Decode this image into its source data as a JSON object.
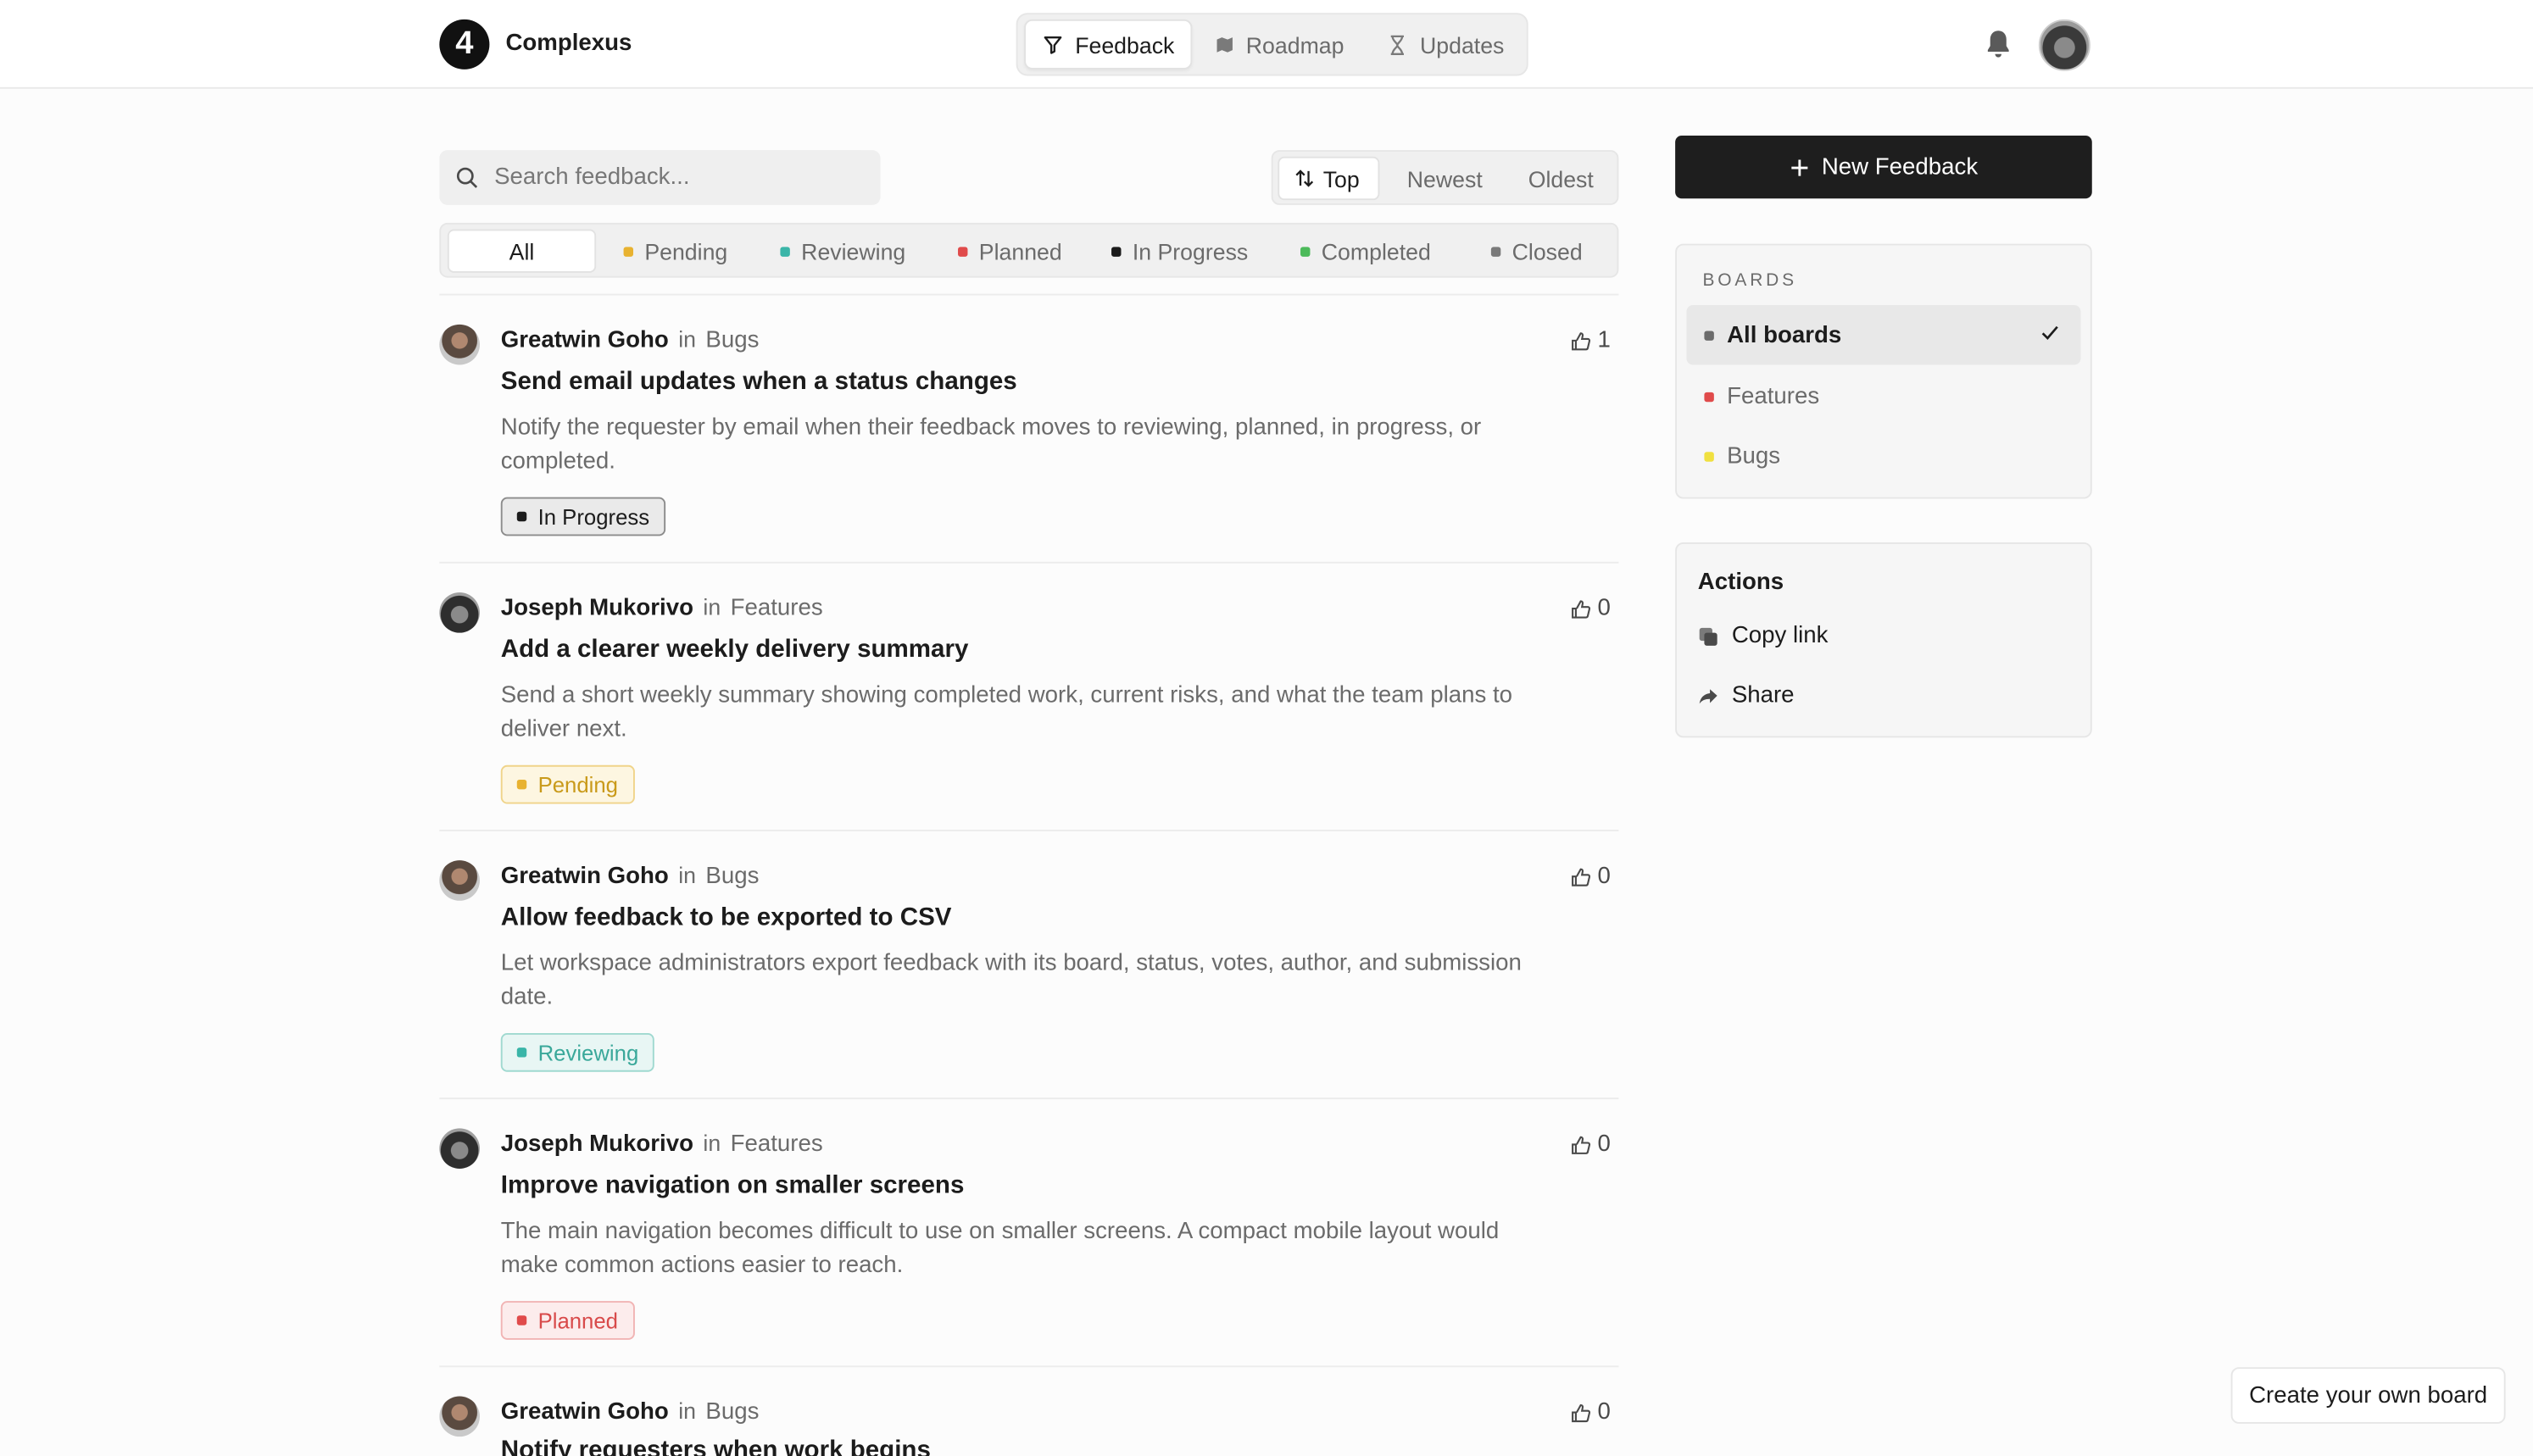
{
  "header": {
    "brand": "Complexus",
    "logo_text": "4",
    "tabs": [
      {
        "label": "Feedback",
        "icon": "filter-funnel-icon",
        "active": true
      },
      {
        "label": "Roadmap",
        "icon": "map-icon",
        "active": false
      },
      {
        "label": "Updates",
        "icon": "hourglass-icon",
        "active": false
      }
    ]
  },
  "search": {
    "placeholder": "Search feedback..."
  },
  "sort": {
    "options": [
      "Top",
      "Newest",
      "Oldest"
    ],
    "selected": "Top"
  },
  "filters": {
    "options": [
      {
        "label": "All",
        "color": null
      },
      {
        "label": "Pending",
        "color": "#e8b230"
      },
      {
        "label": "Reviewing",
        "color": "#3ab5a8"
      },
      {
        "label": "Planned",
        "color": "#e04b4b"
      },
      {
        "label": "In Progress",
        "color": "#1c1c1c"
      },
      {
        "label": "Completed",
        "color": "#4cba5a"
      },
      {
        "label": "Closed",
        "color": "#7a7a7a"
      }
    ],
    "selected": "All"
  },
  "posts": [
    {
      "author": "Greatwin Goho",
      "in": "in",
      "board": "Bugs",
      "votes": "1",
      "title": "Send email updates when a status changes",
      "description": "Notify the requester by email when their feedback moves to reviewing, planned, in progress, or completed.",
      "status": "In Progress"
    },
    {
      "author": "Joseph Mukorivo",
      "in": "in",
      "board": "Features",
      "votes": "0",
      "title": "Add a clearer weekly delivery summary",
      "description": "Send a short weekly summary showing completed work, current risks, and what the team plans to deliver next.",
      "status": "Pending"
    },
    {
      "author": "Greatwin Goho",
      "in": "in",
      "board": "Bugs",
      "votes": "0",
      "title": "Allow feedback to be exported to CSV",
      "description": "Let workspace administrators export feedback with its board, status, votes, author, and submission date.",
      "status": "Reviewing"
    },
    {
      "author": "Joseph Mukorivo",
      "in": "in",
      "board": "Features",
      "votes": "0",
      "title": "Improve navigation on smaller screens",
      "description": "The main navigation becomes difficult to use on smaller screens. A compact mobile layout would make common actions easier to reach.",
      "status": "Planned"
    },
    {
      "author": "Greatwin Goho",
      "in": "in",
      "board": "Bugs",
      "votes": "0",
      "title": "Notify requesters when work begins",
      "description": "",
      "status": ""
    }
  ],
  "sidebar": {
    "new_feedback_label": "New Feedback",
    "boards_heading": "BOARDS",
    "boards": [
      {
        "label": "All boards",
        "color": "#6b6b6b",
        "selected": true
      },
      {
        "label": "Features",
        "color": "#e04b4b",
        "selected": false
      },
      {
        "label": "Bugs",
        "color": "#f0e040",
        "selected": false
      }
    ],
    "actions_heading": "Actions",
    "actions": [
      {
        "label": "Copy link",
        "icon": "copy-icon"
      },
      {
        "label": "Share",
        "icon": "share-arrow-icon"
      }
    ]
  },
  "footer": {
    "create_board_label": "Create your own board"
  },
  "colors": {
    "primary_button": "#1e1e1e",
    "background": "#fcfcfc"
  }
}
